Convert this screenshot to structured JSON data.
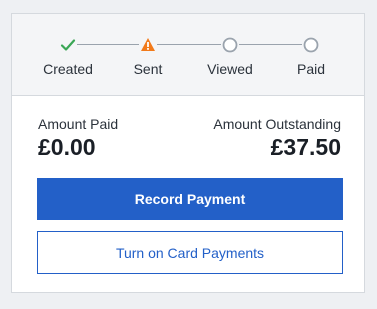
{
  "status_steps": [
    {
      "label": "Created",
      "state": "complete",
      "icon": "check-icon",
      "color": "#3aa655"
    },
    {
      "label": "Sent",
      "state": "warning",
      "icon": "warning-icon",
      "color": "#f27a1a"
    },
    {
      "label": "Viewed",
      "state": "pending",
      "icon": "circle-icon",
      "color": "#9aa3ad"
    },
    {
      "label": "Paid",
      "state": "pending",
      "icon": "circle-icon",
      "color": "#9aa3ad"
    }
  ],
  "amounts": {
    "paid_label": "Amount Paid",
    "paid_value": "£0.00",
    "outstanding_label": "Amount Outstanding",
    "outstanding_value": "£37.50"
  },
  "actions": {
    "record_payment_label": "Record Payment",
    "card_payments_label": "Turn on Card Payments"
  },
  "colors": {
    "accent": "#2360c8"
  }
}
